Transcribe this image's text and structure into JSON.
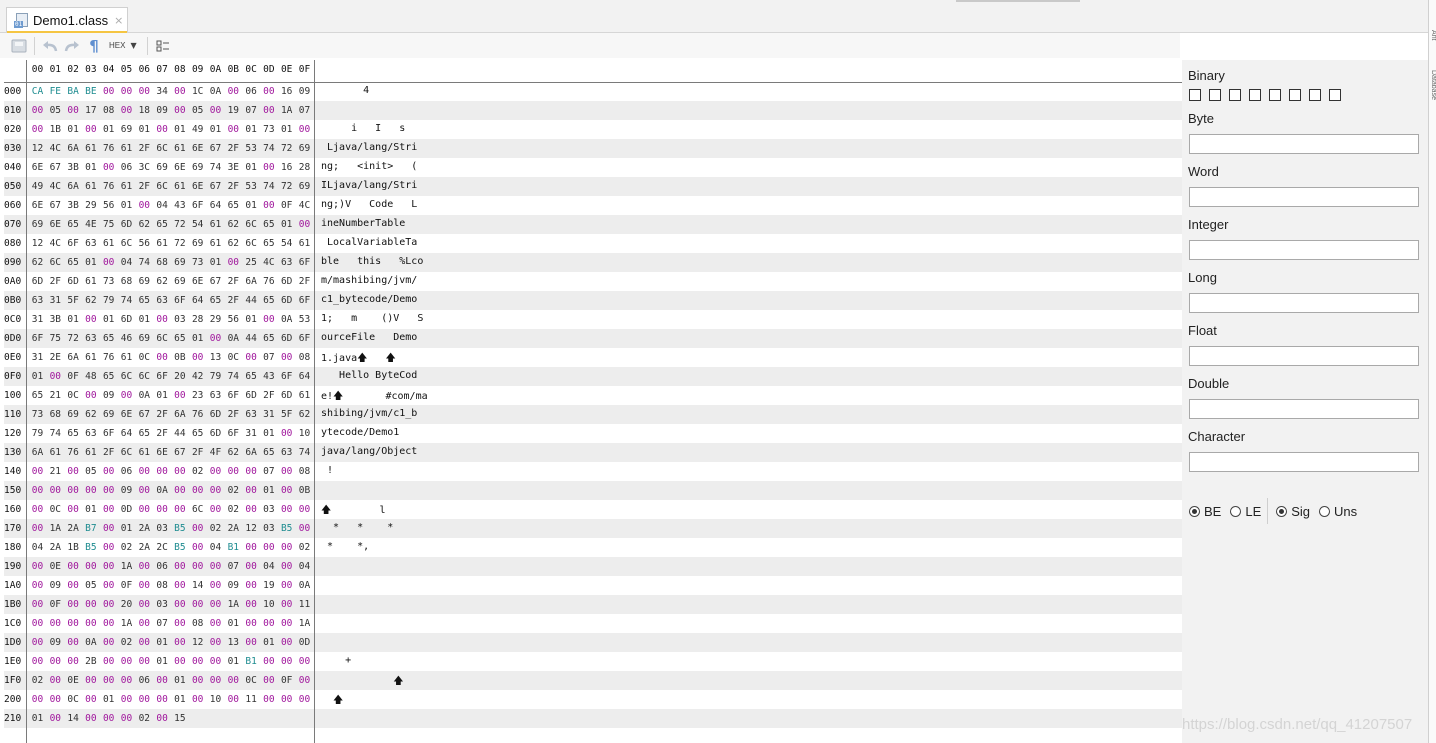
{
  "tab": {
    "title": "Demo1.class",
    "close": "×",
    "icon_badge": "01"
  },
  "toolbar": {
    "format": "HEX",
    "format_caret": "▼",
    "paragraph_glyph": "¶"
  },
  "grid": {
    "header": [
      "00",
      "01",
      "02",
      "03",
      "04",
      "05",
      "06",
      "07",
      "08",
      "09",
      "0A",
      "0B",
      "0C",
      "0D",
      "0E",
      "0F"
    ],
    "rows": [
      {
        "addr": "000",
        "hex": "CA FE BA BE 00 00 00 34 00 1C 0A 00 06 00 16 09",
        "ascii": "       4"
      },
      {
        "addr": "010",
        "hex": "00 05 00 17 08 00 18 09 00 05 00 19 07 00 1A 07",
        "ascii": ""
      },
      {
        "addr": "020",
        "hex": "00 1B 01 00 01 69 01 00 01 49 01 00 01 73 01 00",
        "ascii": "     i   I   s"
      },
      {
        "addr": "030",
        "hex": "12 4C 6A 61 76 61 2F 6C 61 6E 67 2F 53 74 72 69",
        "ascii": " Ljava/lang/Stri"
      },
      {
        "addr": "040",
        "hex": "6E 67 3B 01 00 06 3C 69 6E 69 74 3E 01 00 16 28",
        "ascii": "ng;   <init>   ("
      },
      {
        "addr": "050",
        "hex": "49 4C 6A 61 76 61 2F 6C 61 6E 67 2F 53 74 72 69",
        "ascii": "ILjava/lang/Stri"
      },
      {
        "addr": "060",
        "hex": "6E 67 3B 29 56 01 00 04 43 6F 64 65 01 00 0F 4C",
        "ascii": "ng;)V   Code   L"
      },
      {
        "addr": "070",
        "hex": "69 6E 65 4E 75 6D 62 65 72 54 61 62 6C 65 01 00",
        "ascii": "ineNumberTable"
      },
      {
        "addr": "080",
        "hex": "12 4C 6F 63 61 6C 56 61 72 69 61 62 6C 65 54 61",
        "ascii": " LocalVariableTa"
      },
      {
        "addr": "090",
        "hex": "62 6C 65 01 00 04 74 68 69 73 01 00 25 4C 63 6F",
        "ascii": "ble   this   %Lco"
      },
      {
        "addr": "0A0",
        "hex": "6D 2F 6D 61 73 68 69 62 69 6E 67 2F 6A 76 6D 2F",
        "ascii": "m/mashibing/jvm/"
      },
      {
        "addr": "0B0",
        "hex": "63 31 5F 62 79 74 65 63 6F 64 65 2F 44 65 6D 6F",
        "ascii": "c1_bytecode/Demo"
      },
      {
        "addr": "0C0",
        "hex": "31 3B 01 00 01 6D 01 00 03 28 29 56 01 00 0A 53",
        "ascii": "1;   m    ()V   S"
      },
      {
        "addr": "0D0",
        "hex": "6F 75 72 63 65 46 69 6C 65 01 00 0A 44 65 6D 6F",
        "ascii": "ourceFile   Demo"
      },
      {
        "addr": "0E0",
        "hex": "31 2E 6A 61 76 61 0C 00 0B 00 13 0C 00 07 00 08",
        "ascii": "1.java🡅   🡅"
      },
      {
        "addr": "0F0",
        "hex": "01 00 0F 48 65 6C 6C 6F 20 42 79 74 65 43 6F 64",
        "ascii": "   Hello ByteCod"
      },
      {
        "addr": "100",
        "hex": "65 21 0C 00 09 00 0A 01 00 23 63 6F 6D 2F 6D 61",
        "ascii": "e!🡅       #com/ma"
      },
      {
        "addr": "110",
        "hex": "73 68 69 62 69 6E 67 2F 6A 76 6D 2F 63 31 5F 62",
        "ascii": "shibing/jvm/c1_b"
      },
      {
        "addr": "120",
        "hex": "79 74 65 63 6F 64 65 2F 44 65 6D 6F 31 01 00 10",
        "ascii": "ytecode/Demo1"
      },
      {
        "addr": "130",
        "hex": "6A 61 76 61 2F 6C 61 6E 67 2F 4F 62 6A 65 63 74",
        "ascii": "java/lang/Object"
      },
      {
        "addr": "140",
        "hex": "00 21 00 05 00 06 00 00 00 02 00 00 00 07 00 08",
        "ascii": " !"
      },
      {
        "addr": "150",
        "hex": "00 00 00 00 00 09 00 0A 00 00 00 02 00 01 00 0B",
        "ascii": ""
      },
      {
        "addr": "160",
        "hex": "00 0C 00 01 00 0D 00 00 00 6C 00 02 00 03 00 00",
        "ascii": "🡅        l"
      },
      {
        "addr": "170",
        "hex": "00 1A 2A B7 00 01 2A 03 B5 00 02 2A 12 03 B5 00",
        "ascii": "  *   *    *"
      },
      {
        "addr": "180",
        "hex": "04 2A 1B B5 00 02 2A 2C B5 00 04 B1 00 00 00 02",
        "ascii": " *    *,"
      },
      {
        "addr": "190",
        "hex": "00 0E 00 00 00 1A 00 06 00 00 00 07 00 04 00 04",
        "ascii": ""
      },
      {
        "addr": "1A0",
        "hex": "00 09 00 05 00 0F 00 08 00 14 00 09 00 19 00 0A",
        "ascii": ""
      },
      {
        "addr": "1B0",
        "hex": "00 0F 00 00 00 20 00 03 00 00 00 1A 00 10 00 11",
        "ascii": ""
      },
      {
        "addr": "1C0",
        "hex": "00 00 00 00 00 1A 00 07 00 08 00 01 00 00 00 1A",
        "ascii": ""
      },
      {
        "addr": "1D0",
        "hex": "00 09 00 0A 00 02 00 01 00 12 00 13 00 01 00 0D",
        "ascii": ""
      },
      {
        "addr": "1E0",
        "hex": "00 00 00 2B 00 00 00 01 00 00 00 01 B1 00 00 00",
        "ascii": "    +"
      },
      {
        "addr": "1F0",
        "hex": "02 00 0E 00 00 00 06 00 01 00 00 00 0C 00 0F 00",
        "ascii": "            🡅"
      },
      {
        "addr": "200",
        "hex": "00 00 0C 00 01 00 00 00 01 00 10 00 11 00 00 00",
        "ascii": "  🡅"
      },
      {
        "addr": "210",
        "hex": "01 00 14 00 00 00 02 00 15",
        "ascii": ""
      }
    ]
  },
  "side": {
    "binary": "Binary",
    "byte": "Byte",
    "word": "Word",
    "integer": "Integer",
    "long": "Long",
    "float": "Float",
    "double": "Double",
    "character": "Character",
    "radios": {
      "be": {
        "label": "BE",
        "checked": true
      },
      "le": {
        "label": "LE",
        "checked": false
      },
      "sig": {
        "label": "Sig",
        "checked": true
      },
      "uns": {
        "label": "Uns",
        "checked": false
      }
    }
  },
  "watermark": "https://blog.csdn.net/qq_41207507",
  "colors": {
    "zero_byte": "#a0169c",
    "nonzero_byte": "#333333",
    "magic_byte": "#1e8c90",
    "tab_accent": "#f5c542"
  }
}
